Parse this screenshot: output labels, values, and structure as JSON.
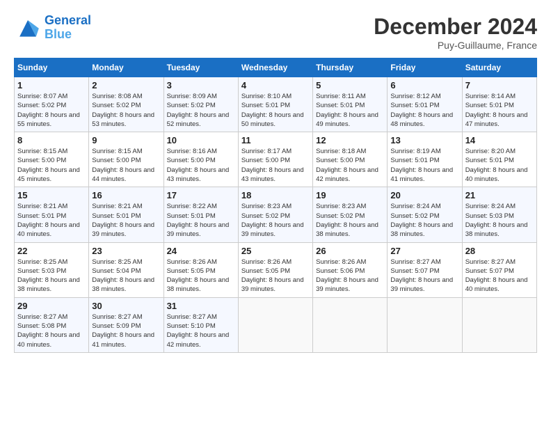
{
  "header": {
    "logo_line1": "General",
    "logo_line2": "Blue",
    "month": "December 2024",
    "location": "Puy-Guillaume, France"
  },
  "days_of_week": [
    "Sunday",
    "Monday",
    "Tuesday",
    "Wednesday",
    "Thursday",
    "Friday",
    "Saturday"
  ],
  "weeks": [
    [
      {
        "day": "1",
        "text": "Sunrise: 8:07 AM\nSunset: 5:02 PM\nDaylight: 8 hours and 55 minutes."
      },
      {
        "day": "2",
        "text": "Sunrise: 8:08 AM\nSunset: 5:02 PM\nDaylight: 8 hours and 53 minutes."
      },
      {
        "day": "3",
        "text": "Sunrise: 8:09 AM\nSunset: 5:02 PM\nDaylight: 8 hours and 52 minutes."
      },
      {
        "day": "4",
        "text": "Sunrise: 8:10 AM\nSunset: 5:01 PM\nDaylight: 8 hours and 50 minutes."
      },
      {
        "day": "5",
        "text": "Sunrise: 8:11 AM\nSunset: 5:01 PM\nDaylight: 8 hours and 49 minutes."
      },
      {
        "day": "6",
        "text": "Sunrise: 8:12 AM\nSunset: 5:01 PM\nDaylight: 8 hours and 48 minutes."
      },
      {
        "day": "7",
        "text": "Sunrise: 8:14 AM\nSunset: 5:01 PM\nDaylight: 8 hours and 47 minutes."
      }
    ],
    [
      {
        "day": "8",
        "text": "Sunrise: 8:15 AM\nSunset: 5:00 PM\nDaylight: 8 hours and 45 minutes."
      },
      {
        "day": "9",
        "text": "Sunrise: 8:15 AM\nSunset: 5:00 PM\nDaylight: 8 hours and 44 minutes."
      },
      {
        "day": "10",
        "text": "Sunrise: 8:16 AM\nSunset: 5:00 PM\nDaylight: 8 hours and 43 minutes."
      },
      {
        "day": "11",
        "text": "Sunrise: 8:17 AM\nSunset: 5:00 PM\nDaylight: 8 hours and 43 minutes."
      },
      {
        "day": "12",
        "text": "Sunrise: 8:18 AM\nSunset: 5:00 PM\nDaylight: 8 hours and 42 minutes."
      },
      {
        "day": "13",
        "text": "Sunrise: 8:19 AM\nSunset: 5:01 PM\nDaylight: 8 hours and 41 minutes."
      },
      {
        "day": "14",
        "text": "Sunrise: 8:20 AM\nSunset: 5:01 PM\nDaylight: 8 hours and 40 minutes."
      }
    ],
    [
      {
        "day": "15",
        "text": "Sunrise: 8:21 AM\nSunset: 5:01 PM\nDaylight: 8 hours and 40 minutes."
      },
      {
        "day": "16",
        "text": "Sunrise: 8:21 AM\nSunset: 5:01 PM\nDaylight: 8 hours and 39 minutes."
      },
      {
        "day": "17",
        "text": "Sunrise: 8:22 AM\nSunset: 5:01 PM\nDaylight: 8 hours and 39 minutes."
      },
      {
        "day": "18",
        "text": "Sunrise: 8:23 AM\nSunset: 5:02 PM\nDaylight: 8 hours and 39 minutes."
      },
      {
        "day": "19",
        "text": "Sunrise: 8:23 AM\nSunset: 5:02 PM\nDaylight: 8 hours and 38 minutes."
      },
      {
        "day": "20",
        "text": "Sunrise: 8:24 AM\nSunset: 5:02 PM\nDaylight: 8 hours and 38 minutes."
      },
      {
        "day": "21",
        "text": "Sunrise: 8:24 AM\nSunset: 5:03 PM\nDaylight: 8 hours and 38 minutes."
      }
    ],
    [
      {
        "day": "22",
        "text": "Sunrise: 8:25 AM\nSunset: 5:03 PM\nDaylight: 8 hours and 38 minutes."
      },
      {
        "day": "23",
        "text": "Sunrise: 8:25 AM\nSunset: 5:04 PM\nDaylight: 8 hours and 38 minutes."
      },
      {
        "day": "24",
        "text": "Sunrise: 8:26 AM\nSunset: 5:05 PM\nDaylight: 8 hours and 38 minutes."
      },
      {
        "day": "25",
        "text": "Sunrise: 8:26 AM\nSunset: 5:05 PM\nDaylight: 8 hours and 39 minutes."
      },
      {
        "day": "26",
        "text": "Sunrise: 8:26 AM\nSunset: 5:06 PM\nDaylight: 8 hours and 39 minutes."
      },
      {
        "day": "27",
        "text": "Sunrise: 8:27 AM\nSunset: 5:07 PM\nDaylight: 8 hours and 39 minutes."
      },
      {
        "day": "28",
        "text": "Sunrise: 8:27 AM\nSunset: 5:07 PM\nDaylight: 8 hours and 40 minutes."
      }
    ],
    [
      {
        "day": "29",
        "text": "Sunrise: 8:27 AM\nSunset: 5:08 PM\nDaylight: 8 hours and 40 minutes."
      },
      {
        "day": "30",
        "text": "Sunrise: 8:27 AM\nSunset: 5:09 PM\nDaylight: 8 hours and 41 minutes."
      },
      {
        "day": "31",
        "text": "Sunrise: 8:27 AM\nSunset: 5:10 PM\nDaylight: 8 hours and 42 minutes."
      },
      {
        "day": "",
        "text": ""
      },
      {
        "day": "",
        "text": ""
      },
      {
        "day": "",
        "text": ""
      },
      {
        "day": "",
        "text": ""
      }
    ]
  ]
}
